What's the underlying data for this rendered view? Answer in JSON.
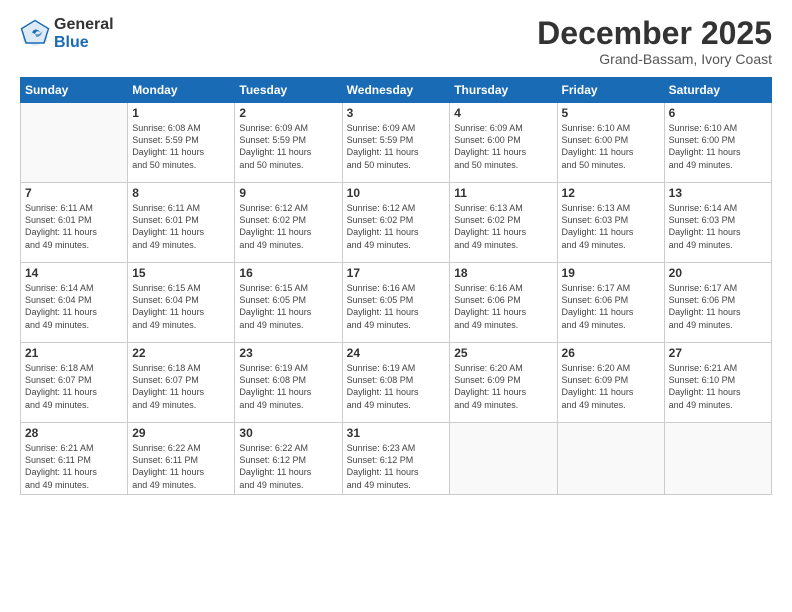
{
  "logo": {
    "general": "General",
    "blue": "Blue"
  },
  "title": "December 2025",
  "subtitle": "Grand-Bassam, Ivory Coast",
  "days_of_week": [
    "Sunday",
    "Monday",
    "Tuesday",
    "Wednesday",
    "Thursday",
    "Friday",
    "Saturday"
  ],
  "weeks": [
    [
      {
        "day": "",
        "info": ""
      },
      {
        "day": "1",
        "info": "Sunrise: 6:08 AM\nSunset: 5:59 PM\nDaylight: 11 hours\nand 50 minutes."
      },
      {
        "day": "2",
        "info": "Sunrise: 6:09 AM\nSunset: 5:59 PM\nDaylight: 11 hours\nand 50 minutes."
      },
      {
        "day": "3",
        "info": "Sunrise: 6:09 AM\nSunset: 5:59 PM\nDaylight: 11 hours\nand 50 minutes."
      },
      {
        "day": "4",
        "info": "Sunrise: 6:09 AM\nSunset: 6:00 PM\nDaylight: 11 hours\nand 50 minutes."
      },
      {
        "day": "5",
        "info": "Sunrise: 6:10 AM\nSunset: 6:00 PM\nDaylight: 11 hours\nand 50 minutes."
      },
      {
        "day": "6",
        "info": "Sunrise: 6:10 AM\nSunset: 6:00 PM\nDaylight: 11 hours\nand 49 minutes."
      }
    ],
    [
      {
        "day": "7",
        "info": "Sunrise: 6:11 AM\nSunset: 6:01 PM\nDaylight: 11 hours\nand 49 minutes."
      },
      {
        "day": "8",
        "info": "Sunrise: 6:11 AM\nSunset: 6:01 PM\nDaylight: 11 hours\nand 49 minutes."
      },
      {
        "day": "9",
        "info": "Sunrise: 6:12 AM\nSunset: 6:02 PM\nDaylight: 11 hours\nand 49 minutes."
      },
      {
        "day": "10",
        "info": "Sunrise: 6:12 AM\nSunset: 6:02 PM\nDaylight: 11 hours\nand 49 minutes."
      },
      {
        "day": "11",
        "info": "Sunrise: 6:13 AM\nSunset: 6:02 PM\nDaylight: 11 hours\nand 49 minutes."
      },
      {
        "day": "12",
        "info": "Sunrise: 6:13 AM\nSunset: 6:03 PM\nDaylight: 11 hours\nand 49 minutes."
      },
      {
        "day": "13",
        "info": "Sunrise: 6:14 AM\nSunset: 6:03 PM\nDaylight: 11 hours\nand 49 minutes."
      }
    ],
    [
      {
        "day": "14",
        "info": "Sunrise: 6:14 AM\nSunset: 6:04 PM\nDaylight: 11 hours\nand 49 minutes."
      },
      {
        "day": "15",
        "info": "Sunrise: 6:15 AM\nSunset: 6:04 PM\nDaylight: 11 hours\nand 49 minutes."
      },
      {
        "day": "16",
        "info": "Sunrise: 6:15 AM\nSunset: 6:05 PM\nDaylight: 11 hours\nand 49 minutes."
      },
      {
        "day": "17",
        "info": "Sunrise: 6:16 AM\nSunset: 6:05 PM\nDaylight: 11 hours\nand 49 minutes."
      },
      {
        "day": "18",
        "info": "Sunrise: 6:16 AM\nSunset: 6:06 PM\nDaylight: 11 hours\nand 49 minutes."
      },
      {
        "day": "19",
        "info": "Sunrise: 6:17 AM\nSunset: 6:06 PM\nDaylight: 11 hours\nand 49 minutes."
      },
      {
        "day": "20",
        "info": "Sunrise: 6:17 AM\nSunset: 6:06 PM\nDaylight: 11 hours\nand 49 minutes."
      }
    ],
    [
      {
        "day": "21",
        "info": "Sunrise: 6:18 AM\nSunset: 6:07 PM\nDaylight: 11 hours\nand 49 minutes."
      },
      {
        "day": "22",
        "info": "Sunrise: 6:18 AM\nSunset: 6:07 PM\nDaylight: 11 hours\nand 49 minutes."
      },
      {
        "day": "23",
        "info": "Sunrise: 6:19 AM\nSunset: 6:08 PM\nDaylight: 11 hours\nand 49 minutes."
      },
      {
        "day": "24",
        "info": "Sunrise: 6:19 AM\nSunset: 6:08 PM\nDaylight: 11 hours\nand 49 minutes."
      },
      {
        "day": "25",
        "info": "Sunrise: 6:20 AM\nSunset: 6:09 PM\nDaylight: 11 hours\nand 49 minutes."
      },
      {
        "day": "26",
        "info": "Sunrise: 6:20 AM\nSunset: 6:09 PM\nDaylight: 11 hours\nand 49 minutes."
      },
      {
        "day": "27",
        "info": "Sunrise: 6:21 AM\nSunset: 6:10 PM\nDaylight: 11 hours\nand 49 minutes."
      }
    ],
    [
      {
        "day": "28",
        "info": "Sunrise: 6:21 AM\nSunset: 6:11 PM\nDaylight: 11 hours\nand 49 minutes."
      },
      {
        "day": "29",
        "info": "Sunrise: 6:22 AM\nSunset: 6:11 PM\nDaylight: 11 hours\nand 49 minutes."
      },
      {
        "day": "30",
        "info": "Sunrise: 6:22 AM\nSunset: 6:12 PM\nDaylight: 11 hours\nand 49 minutes."
      },
      {
        "day": "31",
        "info": "Sunrise: 6:23 AM\nSunset: 6:12 PM\nDaylight: 11 hours\nand 49 minutes."
      },
      {
        "day": "",
        "info": ""
      },
      {
        "day": "",
        "info": ""
      },
      {
        "day": "",
        "info": ""
      }
    ]
  ]
}
